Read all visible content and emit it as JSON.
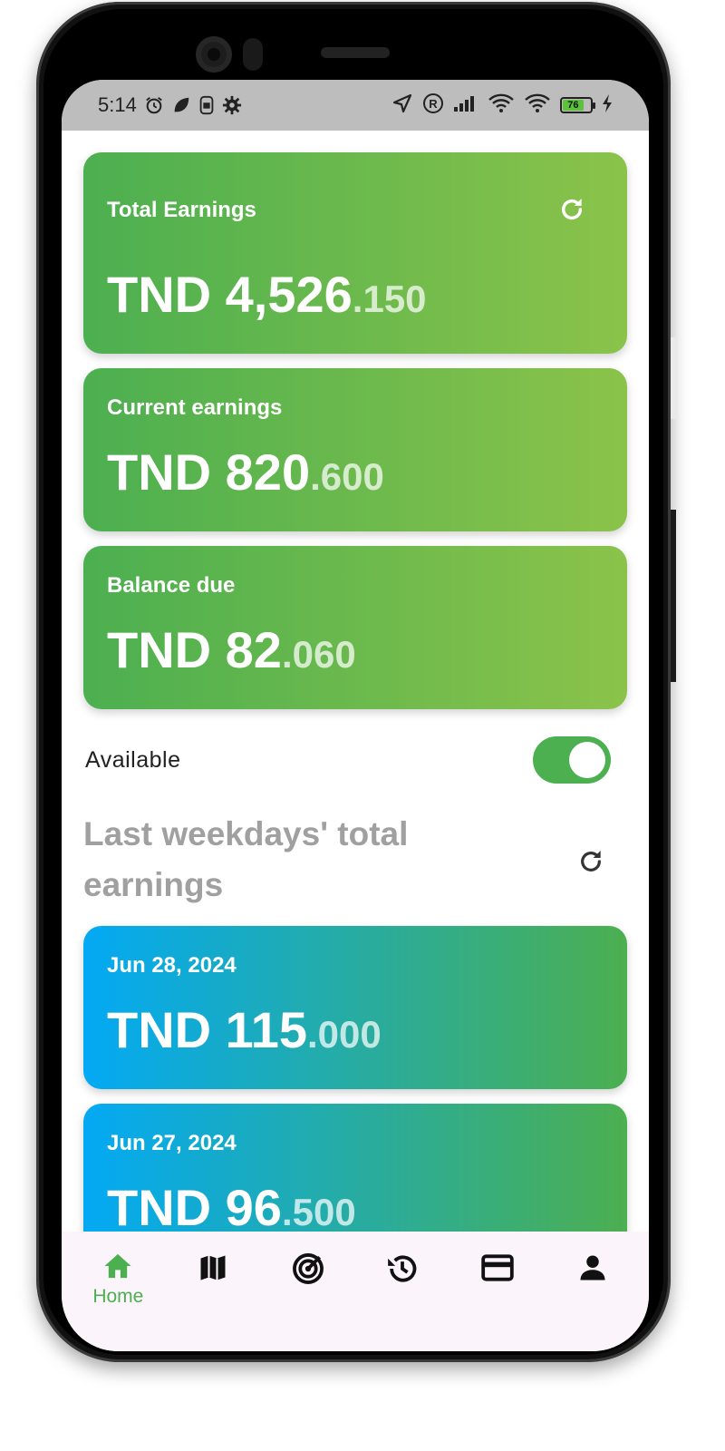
{
  "status_bar": {
    "time": "5:14",
    "battery_level": "76"
  },
  "cards": {
    "total_earnings": {
      "title": "Total Earnings",
      "amount_main": "TND 4,526",
      "amount_decimal": ".150"
    },
    "current_earnings": {
      "title": "Current earnings",
      "amount_main": "TND 820",
      "amount_decimal": ".600"
    },
    "balance_due": {
      "title": "Balance due",
      "amount_main": "TND 82",
      "amount_decimal": ".060"
    }
  },
  "availability": {
    "label": "Available",
    "enabled": true
  },
  "weekdays_section": {
    "title": "Last weekdays' total earnings",
    "days": [
      {
        "date": "Jun 28, 2024",
        "amount_main": "TND 115",
        "amount_decimal": ".000"
      },
      {
        "date": "Jun 27, 2024",
        "amount_main": "TND 96",
        "amount_decimal": ".500"
      }
    ]
  },
  "bottom_nav": {
    "items": [
      {
        "icon": "home-icon",
        "label": "Home",
        "active": true
      },
      {
        "icon": "map-icon",
        "label": ""
      },
      {
        "icon": "radar-icon",
        "label": ""
      },
      {
        "icon": "history-icon",
        "label": ""
      },
      {
        "icon": "card-icon",
        "label": ""
      },
      {
        "icon": "person-icon",
        "label": ""
      }
    ]
  },
  "colors": {
    "green_start": "#4caf50",
    "green_end": "#8bc34a",
    "blue_start": "#03a9f4",
    "accent": "#4caf50",
    "nav_bg": "#fbf4fb"
  }
}
